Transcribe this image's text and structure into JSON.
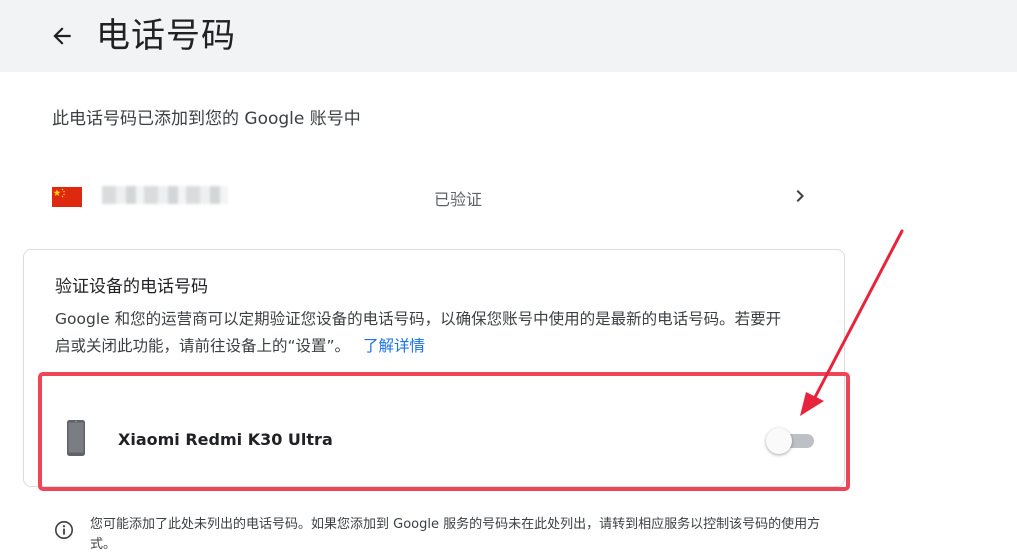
{
  "header": {
    "title": "电话号码",
    "back_icon": "arrow-left-icon"
  },
  "intro_text": "此电话号码已添加到您的 Google 账号中",
  "phone_entry": {
    "flag_icon": "china-flag-icon",
    "status": "已验证",
    "chevron_icon": "chevron-right-icon"
  },
  "verification_card": {
    "title": "验证设备的电话号码",
    "description": "Google 和您的运营商可以定期验证您设备的电话号码，以确保您账号中使用的是最新的电话号码。若要开启或关闭此功能，请前往设备上的“设置”。",
    "learn_more": "了解详情",
    "device": {
      "icon": "smartphone-icon",
      "name": "Xiaomi Redmi K30 Ultra",
      "toggle_on": false
    }
  },
  "footer_note": {
    "icon": "info-icon",
    "text": "您可能添加了此处未列出的电话号码。如果您添加到 Google 服务的号码未在此处列出，请转到相应服务以控制该号码的使用方式。"
  },
  "colors": {
    "header_bg": "#f1f3f4",
    "link": "#1a73e8",
    "highlight": "#ee4559",
    "arrow": "#e8243d",
    "flag_red": "#de2910",
    "flag_star": "#ffde00"
  }
}
